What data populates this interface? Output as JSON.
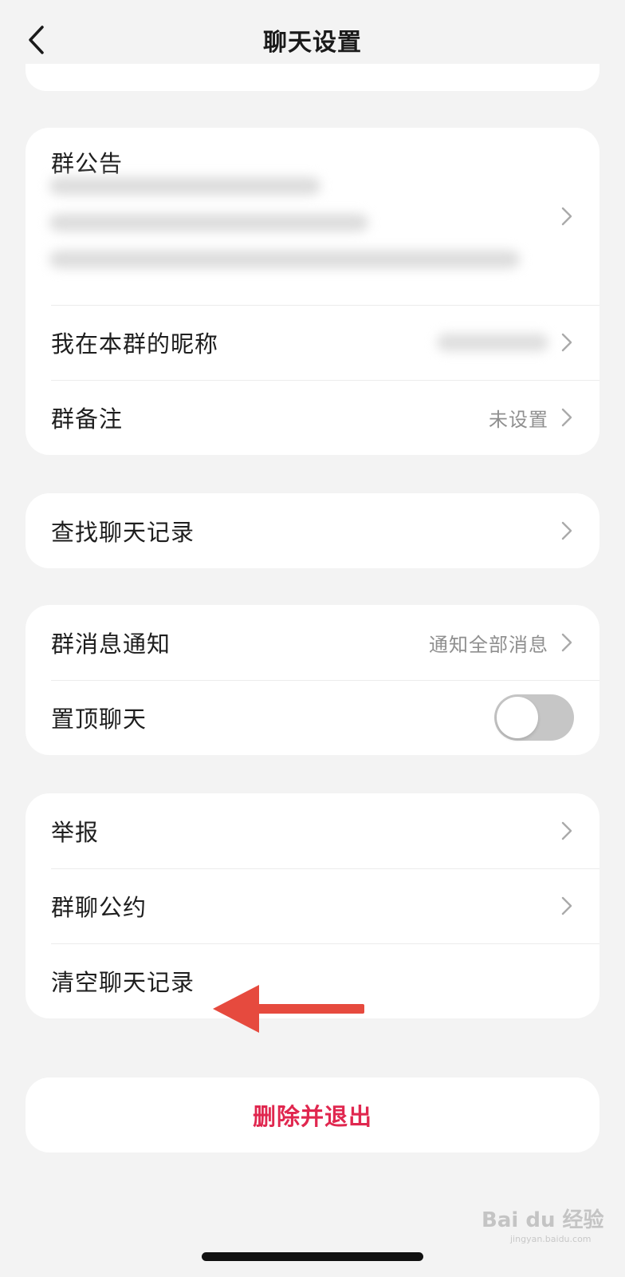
{
  "header": {
    "title": "聊天设置"
  },
  "group_notice": {
    "label": "群公告"
  },
  "rows": {
    "nickname": {
      "label": "我在本群的昵称"
    },
    "remark": {
      "label": "群备注",
      "value": "未设置"
    },
    "search_history": {
      "label": "查找聊天记录"
    },
    "notification": {
      "label": "群消息通知",
      "value": "通知全部消息"
    },
    "pin_chat": {
      "label": "置顶聊天",
      "enabled": false
    },
    "report": {
      "label": "举报"
    },
    "group_rules": {
      "label": "群聊公约"
    },
    "clear_history": {
      "label": "清空聊天记录"
    }
  },
  "danger_action": {
    "label": "删除并退出"
  },
  "watermark": {
    "text": "Bai du 经验",
    "sub": "jingyan.baidu.com"
  },
  "colors": {
    "background": "#f3f3f3",
    "card": "#ffffff",
    "danger": "#e0274f",
    "annotation_arrow": "#e64a3e",
    "toggle_off": "#c6c6c6"
  },
  "icons": {
    "back": "chevron-left-icon",
    "row_chevron": "chevron-right-icon",
    "annotation": "arrow-left-icon"
  }
}
